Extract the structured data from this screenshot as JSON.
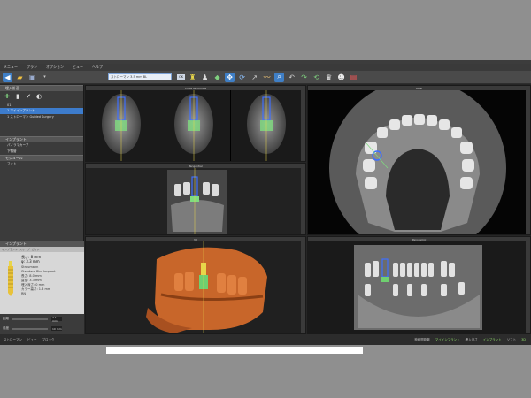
{
  "menu": [
    "メニュー",
    "プラン",
    "オプション",
    "ビュー",
    "ヘルプ"
  ],
  "toolbar": {
    "procedure_text": "ストローマン 3.5 mm BL",
    "ok_label": "OK"
  },
  "left_panel": {
    "section1": "埋入計画",
    "tree_root": "01",
    "tree_selected": "1 マイインプラント",
    "tree_item2": "1 ストローマン Guided Surgery",
    "section2": "インプラント",
    "item_panorama": "パノラマカーブ",
    "item_nerve": "下顎管",
    "section3": "モジュール",
    "item_photo": "フォト"
  },
  "properties": {
    "header": "インプラント",
    "tabs": [
      "インプラント",
      "スリーブ",
      "ガイド"
    ],
    "length": "長さ: 8 mm",
    "diameter": "φ: 3.3 mm",
    "lines": [
      "Straumann",
      "Standard Plus Implant",
      "長さ: 8.0 mm",
      "直径: 3.3 mm",
      "埋入深さ: 0 mm",
      "カラー高さ: 1.8 mm",
      "RN"
    ]
  },
  "sliders": [
    {
      "label": "距離",
      "value": "2.1 mm"
    },
    {
      "label": "角度",
      "value": "10 mm"
    }
  ],
  "viewports": {
    "top_left": "Cross sectionals",
    "axial": "Axial",
    "tangential": "Tangential",
    "render": "3D",
    "panoramic": "Panoramic"
  },
  "status": {
    "left": [
      "ストローマン",
      "ビュー",
      "ブロック"
    ],
    "right": [
      "神経間距離",
      "マイインプラント",
      "埋入深さ",
      "インプラント",
      "ソフト",
      "3D"
    ]
  },
  "colors": {
    "implant_yellow": "#e8d64a",
    "implant_green": "#6fd070",
    "bone_orange": "#c8662a",
    "selection_blue": "#3d7ccc"
  }
}
